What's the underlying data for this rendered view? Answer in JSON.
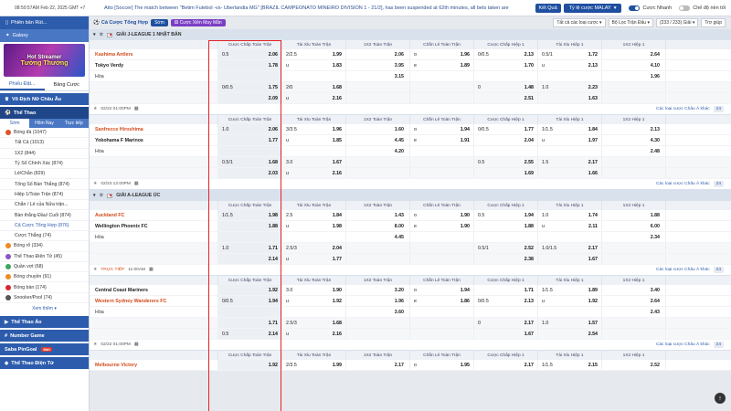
{
  "topbar": {
    "clock": "08:50:57AM Feb 22, 2025 GMT +7",
    "ticker": "Atto [Soccer] The match between \"Betim Futebol -vs- Uberlandia MG\" [BRAZIL CAMPEONATO MINEIRO DIVISION 1 - 21/2], has been suspended at 62th minutes, all bets taken are",
    "results_button": "Kết Quả",
    "odds_type": "Tỷ lệ cược MALAY",
    "fast_bet_label": "Cược Nhanh",
    "dark_mode_label": "Chế độ nền tối"
  },
  "sidebar": {
    "head1": "Phiên bản Rút...",
    "head2": "Galaxy",
    "banner_line1": "Hot Streamer",
    "banner_line2": "Tưởng Thưởng",
    "tabs": [
      "Phiếu Đặt...",
      "Bảng Cược"
    ],
    "champions_label": "Vô Địch Nữ Châu Âu",
    "sport_label": "Thể Thao",
    "mini_tabs": [
      "Sớm",
      "Hôm Nay",
      "Trực tiếp"
    ],
    "items": [
      {
        "label": "Bóng đá (1047)",
        "icon": "dot",
        "sub": false
      },
      {
        "label": "Tất Cả (1013)",
        "sub": true
      },
      {
        "label": "1X2 (844)",
        "sub": true
      },
      {
        "label": "Tỷ Số Chính Xác (874)",
        "sub": true
      },
      {
        "label": "Lẻ/Chẵn (829)",
        "sub": true
      },
      {
        "label": "Tổng Số Bàn Thắng (874)",
        "sub": true
      },
      {
        "label": "Hiệp 1/Toàn Trận (874)",
        "sub": true
      },
      {
        "label": "Chẵn / Lẻ của Nửa trận...",
        "sub": true
      },
      {
        "label": "Bàn thắng Đầu/ Cuối (874)",
        "sub": true
      },
      {
        "label": "Cả Cược Tổng Hợp (876)",
        "sub": true,
        "selected": true
      },
      {
        "label": "Cược Thắng (74)",
        "sub": true
      },
      {
        "label": "Bóng rổ (334)",
        "icon": "dot b"
      },
      {
        "label": "Thể Thao Điện Tử (45)",
        "icon": "dot p"
      },
      {
        "label": "Quần vợt (68)",
        "icon": "dot g"
      },
      {
        "label": "Bóng chuyền (91)",
        "icon": "dot b"
      },
      {
        "label": "Bóng bàn (174)",
        "icon": "dot r"
      },
      {
        "label": "Snooker/Pool (74)",
        "icon": "dot k"
      }
    ],
    "see_more": "Xem thêm",
    "sections": [
      "Thể Thao Ảo",
      "Number Game",
      "Saba PinGoal",
      "Thể Thao Điện Tử"
    ],
    "new_badge": "Mới"
  },
  "toolbar": {
    "title": "Cả Cược Tổng Hợp",
    "early_btn": "Sớm",
    "mix_btn": "Cược Xiên May Mắn",
    "filter1": "Tất cả các loại cược",
    "filter2": "Bộ Lọc Trận Đấu",
    "count": "(233 / 233) Giải",
    "refresh": "Trợ giúp"
  },
  "headers": {
    "team": "",
    "h1": "Cược Chấp Toàn Trận",
    "h2": "Tài Xỉu Toàn Trận",
    "h3": "1X2 Toàn Trận",
    "h4": "Chẵn Lẻ Toàn Trận",
    "h5": "Cược Chấp Hiệp 1",
    "h6": "Tài Xỉu Hiệp 1",
    "h7": "1X2 Hiệp 1"
  },
  "leagues": [
    {
      "name": "GIẢI J-LEAGUE 1 NHẬT BẢN",
      "matches": [
        {
          "rows": [
            {
              "team": "Kashima Antlers",
              "type": "home",
              "hc": [
                "0.5",
                "2.06"
              ],
              "ou": [
                "2/2.5",
                "1.99"
              ],
              "x12": "2.06",
              "oe": [
                "o",
                "1.96"
              ],
              "hc1": [
                "0/0.5",
                "2.13"
              ],
              "ou1": [
                "0.5/1",
                "1.72"
              ],
              "x121": "2.64"
            },
            {
              "team": "Tokyo Verdy",
              "type": "away",
              "hc": [
                "",
                "1.78"
              ],
              "ou": [
                "u",
                "1.83"
              ],
              "x12": "3.95",
              "oe": [
                "e",
                "1.89"
              ],
              "hc1": [
                "",
                "1.70"
              ],
              "ou1": [
                "u",
                "2.13"
              ],
              "x121": "4.10"
            },
            {
              "team": "Hòa",
              "type": "draw",
              "hc": [
                "",
                ""
              ],
              "ou": [
                "",
                ""
              ],
              "x12": "3.15",
              "oe": [
                "",
                ""
              ],
              "hc1": [
                "",
                ""
              ],
              "ou1": [
                "",
                ""
              ],
              "x121": "1.96"
            },
            {
              "team": "",
              "type": "draw",
              "hc": [
                "0/0.5",
                "1.75"
              ],
              "ou": [
                "2/0",
                "1.68"
              ],
              "x12": "",
              "oe": [
                "",
                ""
              ],
              "hc1": [
                "0",
                "1.48"
              ],
              "ou1": [
                "1.0",
                "2.23"
              ],
              "x121": ""
            },
            {
              "team": "",
              "type": "draw",
              "hc": [
                "",
                "2.09"
              ],
              "ou": [
                "u",
                "2.16"
              ],
              "x12": "",
              "oe": [
                "",
                ""
              ],
              "hc1": [
                "",
                "2.51"
              ],
              "ou1": [
                "",
                "1.63"
              ],
              "x121": ""
            }
          ],
          "foot": {
            "time": "02/22 01:00PM",
            "live": false,
            "more": "Các loại cược Châu Á khác",
            "count": "24"
          }
        },
        {
          "rows": [
            {
              "team": "Sanfrecce Hiroshima",
              "type": "home",
              "hc": [
                "1.0",
                "2.06"
              ],
              "ou": [
                "3/3.5",
                "1.96"
              ],
              "x12": "1.60",
              "oe": [
                "o",
                "1.94"
              ],
              "hc1": [
                "0/0.5",
                "1.77"
              ],
              "ou1": [
                "1/1.5",
                "1.84"
              ],
              "x121": "2.13"
            },
            {
              "team": "Yokohama F Marinos",
              "type": "away",
              "hc": [
                "",
                "1.77"
              ],
              "ou": [
                "u",
                "1.85"
              ],
              "x12": "4.45",
              "oe": [
                "e",
                "1.91"
              ],
              "hc1": [
                "",
                "2.04"
              ],
              "ou1": [
                "u",
                "1.97"
              ],
              "x121": "4.30"
            },
            {
              "team": "Hòa",
              "type": "draw",
              "hc": [
                "",
                ""
              ],
              "ou": [
                "",
                ""
              ],
              "x12": "4.20",
              "oe": [
                "",
                ""
              ],
              "hc1": [
                "",
                ""
              ],
              "ou1": [
                "",
                ""
              ],
              "x121": "2.48"
            },
            {
              "team": "",
              "type": "draw",
              "hc": [
                "0.5/1",
                "1.68"
              ],
              "ou": [
                "3.0",
                "1.67"
              ],
              "x12": "",
              "oe": [
                "",
                ""
              ],
              "hc1": [
                "0.5",
                "2.55"
              ],
              "ou1": [
                "1.5",
                "2.17"
              ],
              "x121": ""
            },
            {
              "team": "",
              "type": "draw",
              "hc": [
                "",
                "2.03"
              ],
              "ou": [
                "u",
                "2.16"
              ],
              "x12": "",
              "oe": [
                "",
                ""
              ],
              "hc1": [
                "",
                "1.69"
              ],
              "ou1": [
                "",
                "1.66"
              ],
              "x121": ""
            }
          ],
          "foot": {
            "time": "02/23 12:00PM",
            "live": false,
            "more": "Các loại cược Châu Á khác",
            "count": "24"
          }
        }
      ]
    },
    {
      "name": "GIẢI A-LEAGUE ÚC",
      "matches": [
        {
          "rows": [
            {
              "team": "Auckland FC",
              "type": "home",
              "hc": [
                "1/1.5",
                "1.98"
              ],
              "ou": [
                "2.5",
                "1.84"
              ],
              "x12": "1.43",
              "oe": [
                "o",
                "1.90"
              ],
              "hc1": [
                "0.5",
                "1.94"
              ],
              "ou1": [
                "1.0",
                "1.74"
              ],
              "x121": "1.88"
            },
            {
              "team": "Wellington Phoenix FC",
              "type": "away",
              "hc": [
                "",
                "1.88"
              ],
              "ou": [
                "u",
                "1.98"
              ],
              "x12": "8.00",
              "oe": [
                "e",
                "1.90"
              ],
              "hc1": [
                "",
                "1.88"
              ],
              "ou1": [
                "u",
                "2.11"
              ],
              "x121": "6.00"
            },
            {
              "team": "Hòa",
              "type": "draw",
              "hc": [
                "",
                ""
              ],
              "ou": [
                "",
                ""
              ],
              "x12": "4.45",
              "oe": [
                "",
                ""
              ],
              "hc1": [
                "",
                ""
              ],
              "ou1": [
                "",
                ""
              ],
              "x121": "2.34"
            },
            {
              "team": "",
              "type": "draw",
              "hc": [
                "1.0",
                "1.71"
              ],
              "ou": [
                "2.5/3",
                "2.04"
              ],
              "x12": "",
              "oe": [
                "",
                ""
              ],
              "hc1": [
                "0.5/1",
                "2.52"
              ],
              "ou1": [
                "1.0/1.5",
                "2.17"
              ],
              "x121": ""
            },
            {
              "team": "",
              "type": "draw",
              "hc": [
                "",
                "2.14"
              ],
              "ou": [
                "u",
                "1.77"
              ],
              "x12": "",
              "oe": [
                "",
                ""
              ],
              "hc1": [
                "",
                "2.38"
              ],
              "ou1": [
                "",
                "1.67"
              ],
              "x121": ""
            }
          ],
          "foot": {
            "time": "11:00AM",
            "live": true,
            "live_label": "TRỰC TIẾP",
            "more": "Các loại cược Châu Á khác",
            "count": "24"
          }
        },
        {
          "rows": [
            {
              "team": "Central Coast Mariners",
              "type": "away",
              "hc": [
                "",
                "1.92"
              ],
              "ou": [
                "3.0",
                "1.90"
              ],
              "x12": "3.20",
              "oe": [
                "o",
                "1.94"
              ],
              "hc1": [
                "",
                "1.71"
              ],
              "ou1": [
                "1/1.5",
                "1.89"
              ],
              "x121": "3.40"
            },
            {
              "team": "Western Sydney Wanderers FC",
              "type": "home",
              "hc": [
                "0/0.5",
                "1.94"
              ],
              "ou": [
                "u",
                "1.92"
              ],
              "x12": "1.96",
              "oe": [
                "e",
                "1.86"
              ],
              "hc1": [
                "0/0.5",
                "2.13"
              ],
              "ou1": [
                "u",
                "1.92"
              ],
              "x121": "2.64"
            },
            {
              "team": "Hòa",
              "type": "draw",
              "hc": [
                "",
                ""
              ],
              "ou": [
                "",
                ""
              ],
              "x12": "3.60",
              "oe": [
                "",
                ""
              ],
              "hc1": [
                "",
                ""
              ],
              "ou1": [
                "",
                ""
              ],
              "x121": "2.43"
            },
            {
              "team": "",
              "type": "draw",
              "hc": [
                "",
                "1.71"
              ],
              "ou": [
                "2.5/3",
                "1.68"
              ],
              "x12": "",
              "oe": [
                "",
                ""
              ],
              "hc1": [
                "0",
                "2.17"
              ],
              "ou1": [
                "1.0",
                "1.57"
              ],
              "x121": ""
            },
            {
              "team": "",
              "type": "draw",
              "hc": [
                "0.5",
                "2.14"
              ],
              "ou": [
                "u",
                "2.16"
              ],
              "x12": "",
              "oe": [
                "",
                ""
              ],
              "hc1": [
                "",
                "1.67"
              ],
              "ou1": [
                "",
                "2.54"
              ],
              "x121": ""
            }
          ],
          "foot": {
            "time": "02/22 01:00PM",
            "live": false,
            "more": "Các loại cược Châu Á khác",
            "count": "24"
          }
        },
        {
          "rows": [
            {
              "team": "Melbourne Victory",
              "type": "home",
              "hc": [
                "",
                "1.92"
              ],
              "ou": [
                "2/3.5",
                "1.99"
              ],
              "x12": "2.17",
              "oe": [
                "o",
                "1.95"
              ],
              "hc1": [
                "",
                "2.17"
              ],
              "ou1": [
                "1/1.5",
                "2.15"
              ],
              "x121": "2.52"
            }
          ]
        }
      ]
    }
  ],
  "colors": {
    "brand": "#1f4fa0",
    "home": "#d24a1b",
    "highlight": "#e3242b"
  }
}
